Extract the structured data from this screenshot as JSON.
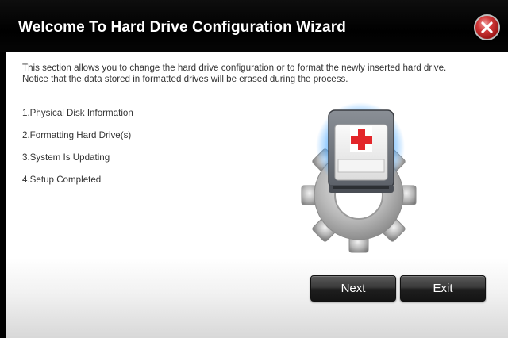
{
  "window": {
    "title": "Welcome To Hard Drive Configuration Wizard"
  },
  "description": "This section allows you to change the hard drive configuration or to format the newly inserted hard drive. Notice that the data stored in formatted drives will be erased during the process.",
  "steps": [
    {
      "label": "1.Physical Disk Information"
    },
    {
      "label": "2.Formatting Hard Drive(s)"
    },
    {
      "label": "3.System Is Updating"
    },
    {
      "label": "4.Setup Completed"
    }
  ],
  "buttons": {
    "next_label": "Next",
    "exit_label": "Exit"
  },
  "icons": {
    "close": "close-icon",
    "illustration": "hard-drive-gear-icon"
  },
  "colors": {
    "titlebar": "#000000",
    "close_red": "#c62828",
    "cross_red": "#e3262b",
    "glow_blue": "#4aa8ff"
  }
}
